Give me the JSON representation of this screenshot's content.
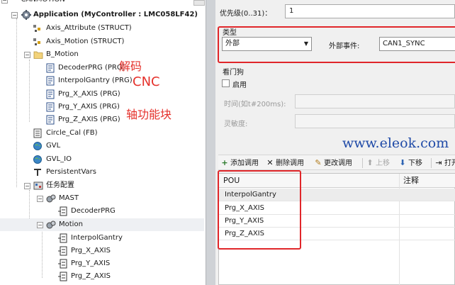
{
  "tree": {
    "top_partial": "CANMOTION",
    "application": "Application (MyController : LMC058LF42)",
    "axis_attribute": "Axis_Attribute (STRUCT)",
    "axis_motion": "Axis_Motion (STRUCT)",
    "b_motion": "B_Motion",
    "decoder_prg": "DecoderPRG (PRG)",
    "interpol_gantry": "InterpolGantry (PRG)",
    "prg_x": "Prg_X_AXIS (PRG)",
    "prg_y": "Prg_Y_AXIS (PRG)",
    "prg_z": "Prg_Z_AXIS (PRG)",
    "circle_cal": "Circle_Cal (FB)",
    "gvl": "GVL",
    "gvl_io": "GVL_IO",
    "persistent": "PersistentVars",
    "task_config": "任务配置",
    "mast": "MAST",
    "mast_decoder": "DecoderPRG",
    "motion": "Motion",
    "m_interpol": "InterpolGantry",
    "m_x": "Prg_X_AXIS",
    "m_y": "Prg_Y_AXIS",
    "m_z": "Prg_Z_AXIS"
  },
  "annotations": {
    "decode": "解码",
    "cnc": "CNC",
    "axis_fb": "轴功能块"
  },
  "task": {
    "priority_label": "优先级(0..31)：",
    "priority_value": "1",
    "type_group": "类型",
    "type_value": "外部",
    "event_label": "外部事件:",
    "event_value": "CAN1_SYNC",
    "watchdog_group": "看门狗",
    "enable_label": "启用",
    "time_label": "时间(如t#200ms):",
    "sensitivity_label": "灵敏度:"
  },
  "toolbar": {
    "add_call": "添加调用",
    "delete_call": "删除调用",
    "change_call": "更改调用",
    "move_up": "上移",
    "move_down": "下移",
    "open": "打开"
  },
  "grid": {
    "col_pou": "POU",
    "col_comment": "注释",
    "rows": [
      "InterpolGantry",
      "Prg_X_AXIS",
      "Prg_Y_AXIS",
      "Prg_Z_AXIS"
    ]
  },
  "watermark": "www.eleok.com"
}
